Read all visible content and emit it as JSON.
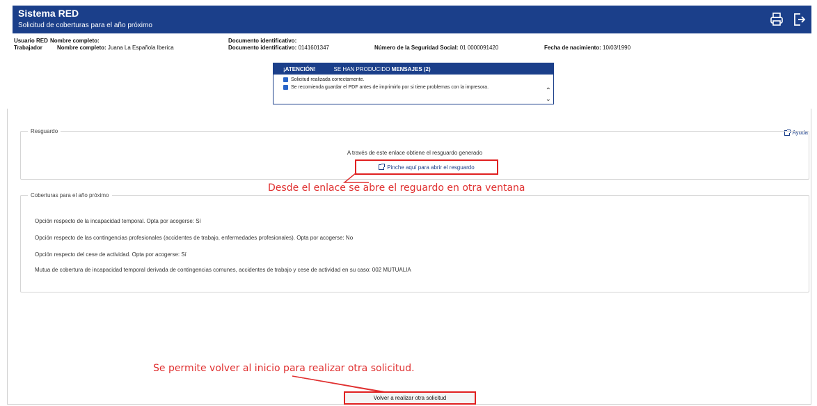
{
  "header": {
    "title": "Sistema RED",
    "subtitle": "Solicitud de coberturas para el año próximo",
    "icons": [
      "printer-icon",
      "logout-icon"
    ]
  },
  "user": {
    "usuario_label": "Usuario RED",
    "nombre_label": "Nombre completo:",
    "nombre_value": "",
    "doc_label": "Documento identificativo:",
    "trabajador_label": "Trabajador",
    "trab_nombre_label": "Nombre completo:",
    "trab_nombre_value": "Juana La Española Iberica",
    "trab_doc_label": "Documento identificativo:",
    "trab_doc_value": "0141601347",
    "nss_label": "Número de la Seguridad Social:",
    "nss_value": "01 0000091420",
    "fecha_label": "Fecha de nacimiento:",
    "fecha_value": "10/03/1990"
  },
  "alert": {
    "attention": "¡ATENCIÓN!",
    "produced": "SE HAN PRODUCIDO",
    "mensajes": "MENSAJES (2)",
    "messages": [
      "Solicitud realizada correctamente.",
      "Se recomienda guardar el PDF antes de imprimirlo por si tiene problemas con la impresora."
    ]
  },
  "ayuda": "Ayuda",
  "resguardo": {
    "legend": "Resguardo",
    "text": "A través de este enlace obtiene el resguardo generado",
    "link": "Pinche aquí para abrir el resguardo"
  },
  "coberturas": {
    "legend": "Coberturas para el año próximo",
    "lines": [
      "Opción respecto de la incapacidad temporal. Opta por acogerse: Sí",
      "Opción respecto de las contingencias profesionales (accidentes de trabajo, enfermedades profesionales). Opta por acogerse: No",
      "Opción respecto del cese de actividad. Opta por acogerse: Sí",
      "Mutua de cobertura de incapacidad temporal derivada de contingencias comunes, accidentes de trabajo y cese de actividad en su caso: 002 MUTUALIA"
    ]
  },
  "annotations": {
    "link_note": "Desde el enlace se abre el reguardo en otra ventana",
    "back_note": "Se permite volver al inicio para realizar otra solicitud."
  },
  "volver_button": "Volver a realizar otra solicitud",
  "colors": {
    "header": "#1b3f8a",
    "annotation": "#e03030"
  }
}
